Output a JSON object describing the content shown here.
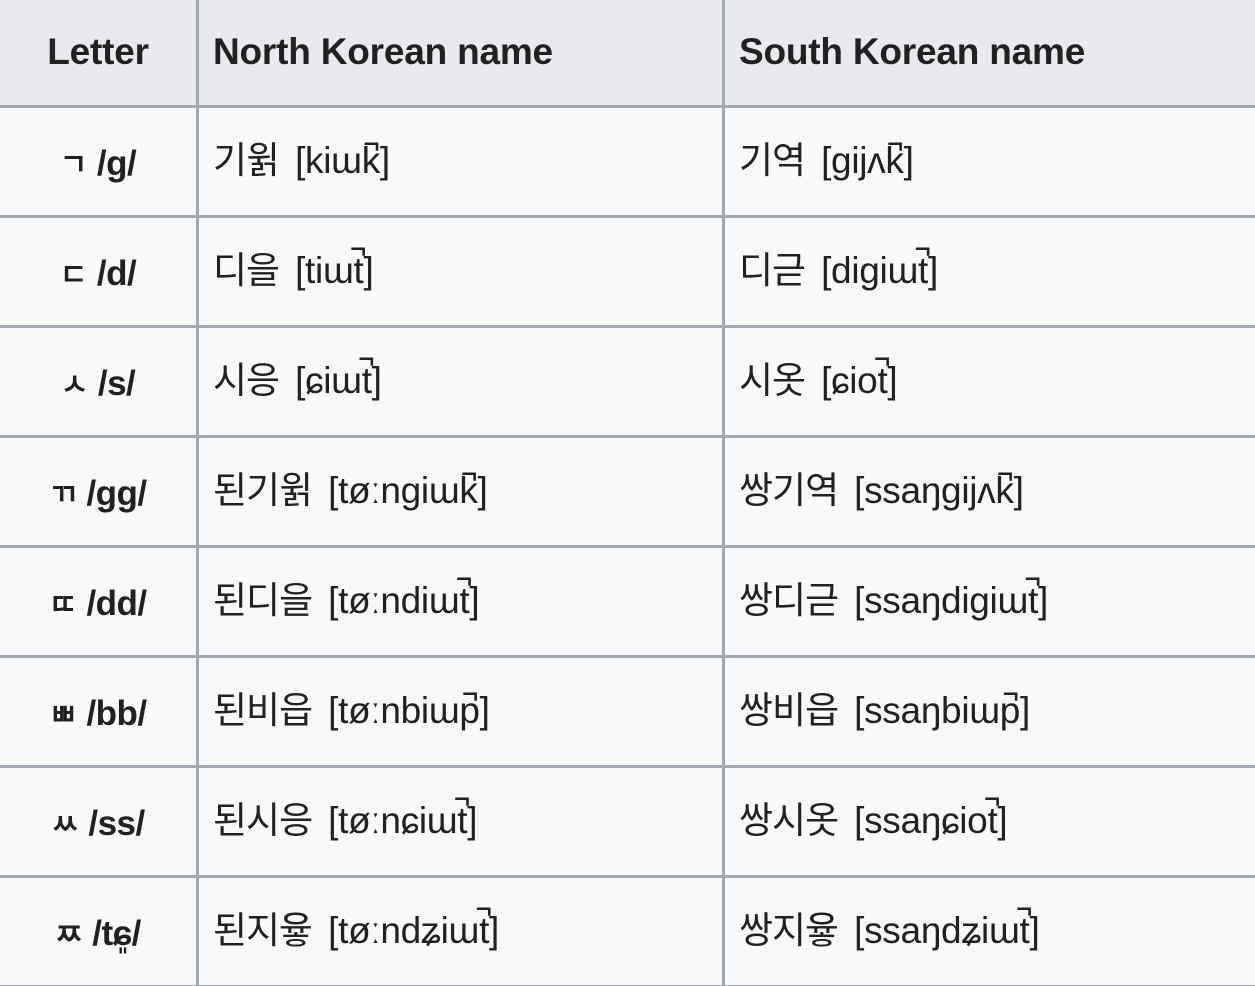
{
  "table": {
    "columns": [
      {
        "key": "letter",
        "label": "Letter"
      },
      {
        "key": "north",
        "label": "North Korean name"
      },
      {
        "key": "south",
        "label": "South Korean name"
      }
    ],
    "rows": [
      {
        "letter_glyph": "ㄱ",
        "letter_romanization": "/g/",
        "north_hangul": "기윍",
        "north_ipa": "[kiɯk̚]",
        "south_hangul": "기역",
        "south_ipa": "[gijʌk̚]"
      },
      {
        "letter_glyph": "ㄷ",
        "letter_romanization": "/d/",
        "north_hangul": "디을",
        "north_ipa": "[tiɯt̚]",
        "south_hangul": "디귿",
        "south_ipa": "[digiɯt̚]"
      },
      {
        "letter_glyph": "ㅅ",
        "letter_romanization": "/s/",
        "north_hangul": "시응",
        "north_ipa": "[ɕiɯt̚]",
        "south_hangul": "시옷",
        "south_ipa": "[ɕiot̚]"
      },
      {
        "letter_glyph": "ㄲ",
        "letter_romanization": "/gg/",
        "north_hangul": "된기윍",
        "north_ipa": "[tøːngiɯk̚]",
        "south_hangul": "쌍기역",
        "south_ipa": "[ssaŋgijʌk̚]"
      },
      {
        "letter_glyph": "ㄸ",
        "letter_romanization": "/dd/",
        "north_hangul": "된디을",
        "north_ipa": "[tøːndiɯt̚]",
        "south_hangul": "쌍디귿",
        "south_ipa": "[ssaŋdigiɯt̚]"
      },
      {
        "letter_glyph": "ㅃ",
        "letter_romanization": "/bb/",
        "north_hangul": "된비읍",
        "north_ipa": "[tøːnbiɯp̚]",
        "south_hangul": "쌍비읍",
        "south_ipa": "[ssaŋbiɯp̚]"
      },
      {
        "letter_glyph": "ㅆ",
        "letter_romanization": "/ss/",
        "north_hangul": "된시응",
        "north_ipa": "[tøːnɕiɯt̚]",
        "south_hangul": "쌍시옷",
        "south_ipa": "[ssaŋɕiot̚]"
      },
      {
        "letter_glyph": "ㅉ",
        "letter_romanization": "/tɕ͈/",
        "north_hangul": "된지윻",
        "north_ipa": "[tøːndʑiɯt̚]",
        "south_hangul": "쌍지윻",
        "south_ipa": "[ssaŋdʑiɯt̚]"
      }
    ]
  },
  "colors": {
    "header_background": "#e8eaed",
    "cell_background": "#f8f9fa",
    "border": "#a2a9b1",
    "text": "#202122"
  }
}
